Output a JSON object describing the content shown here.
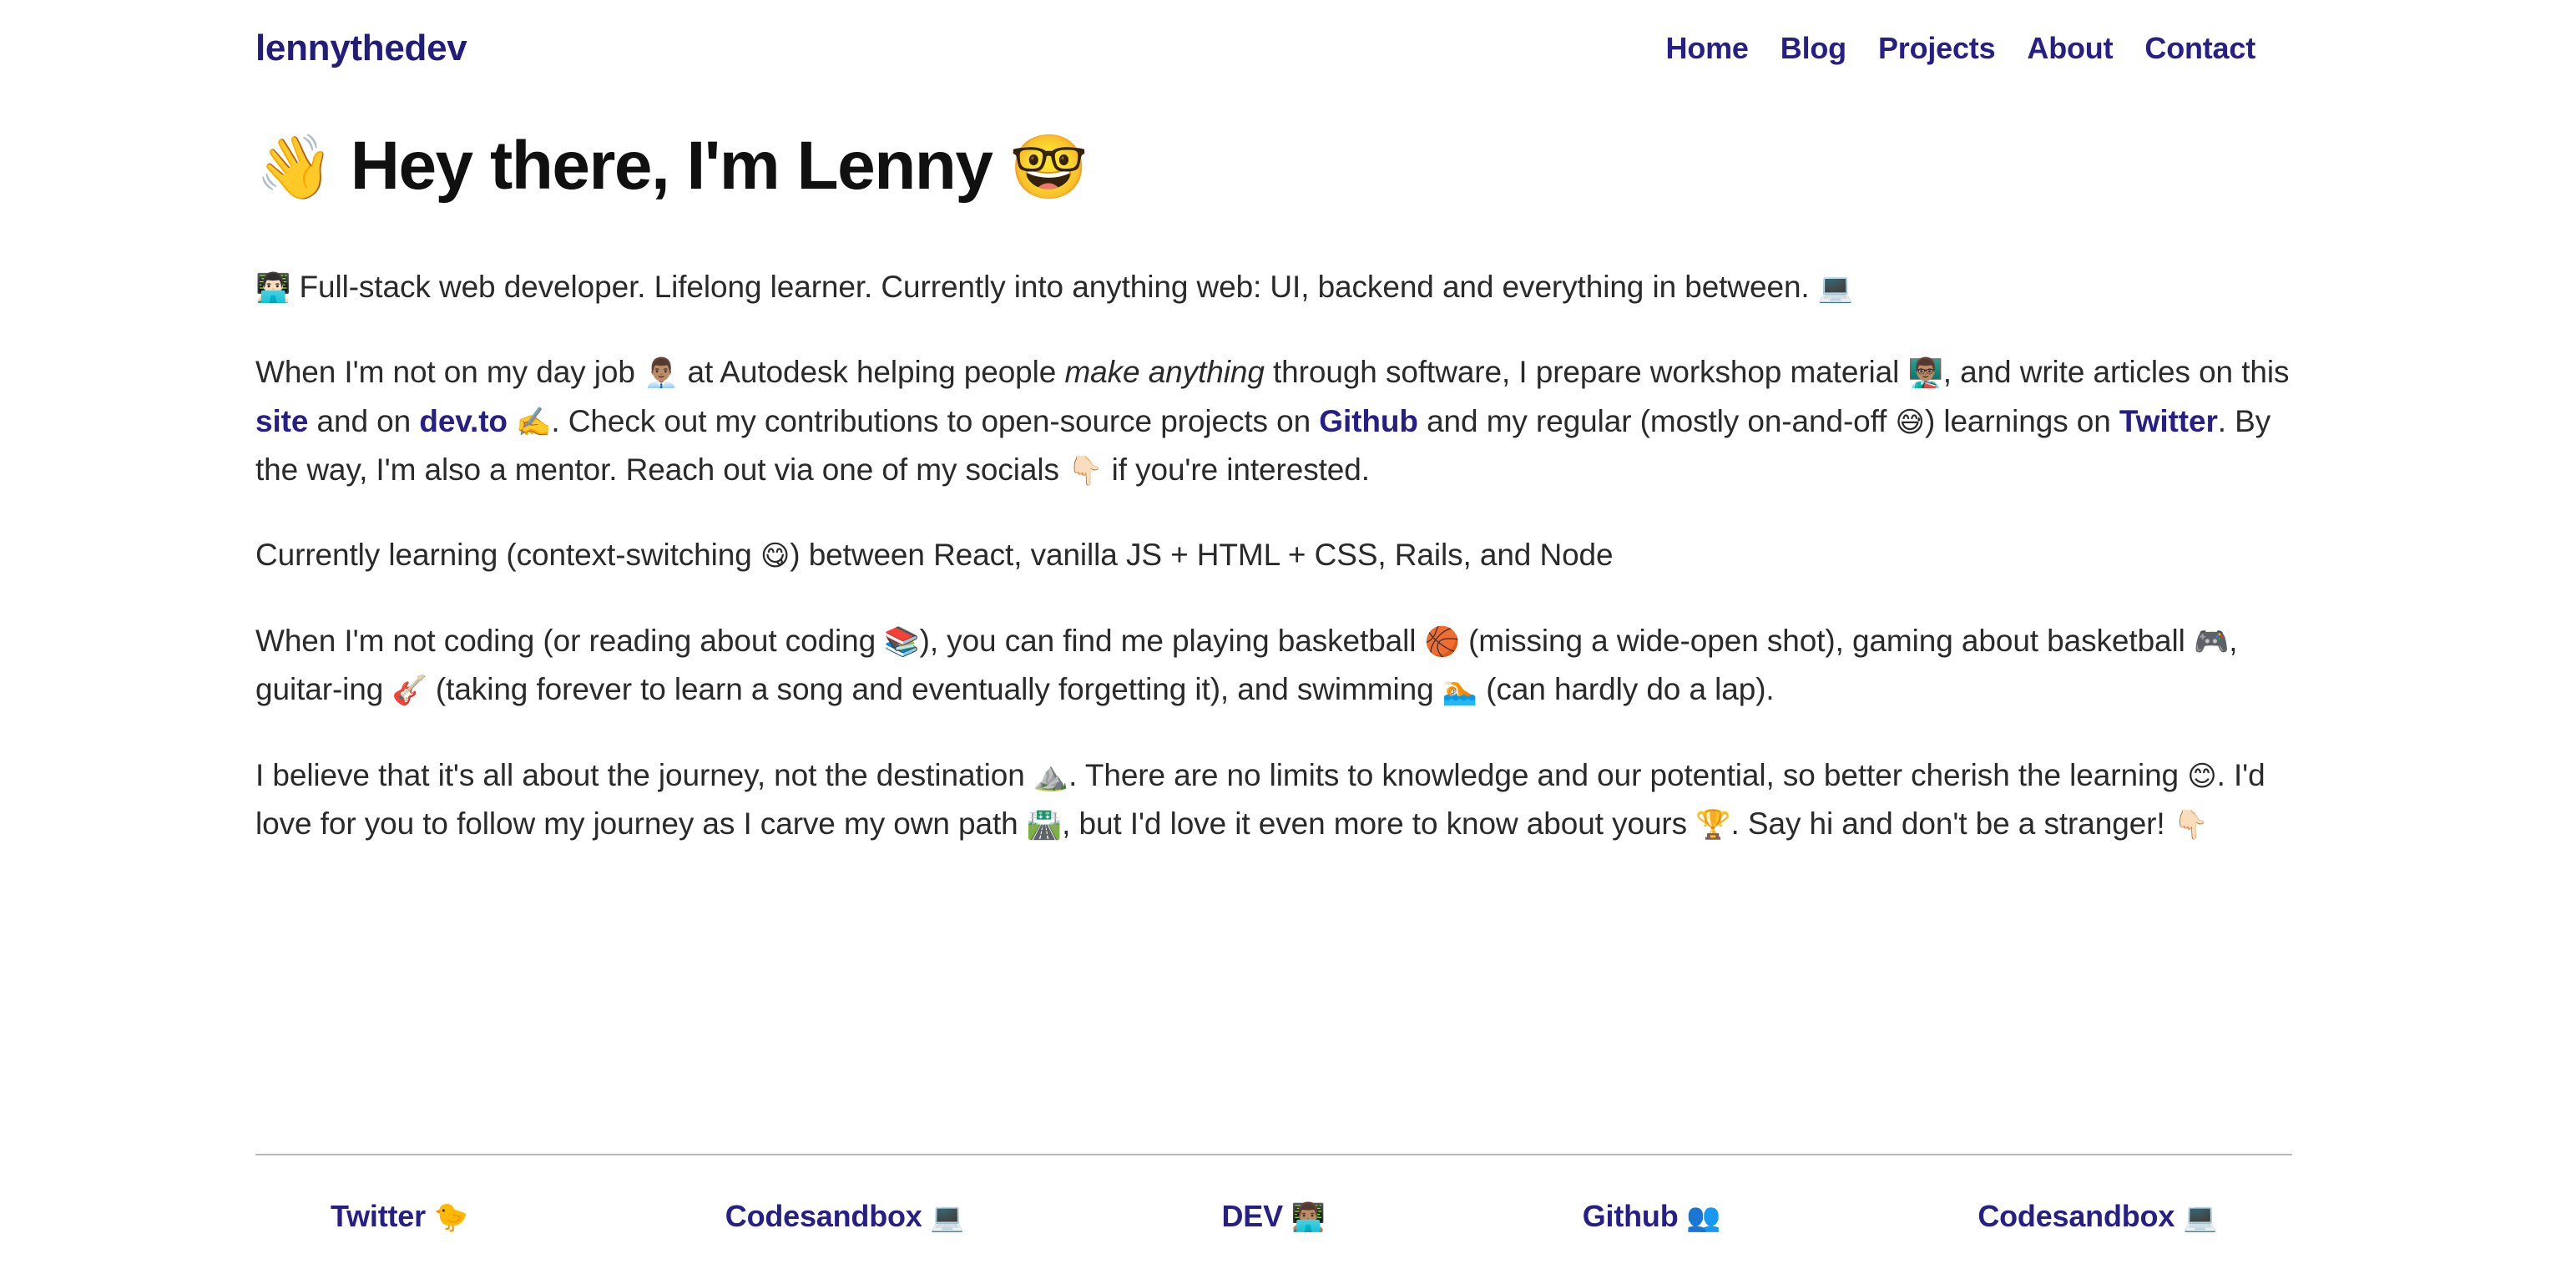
{
  "header": {
    "brand": "lennythedev",
    "nav": [
      {
        "label": "Home",
        "name": "nav-link-home"
      },
      {
        "label": "Blog",
        "name": "nav-link-blog"
      },
      {
        "label": "Projects",
        "name": "nav-link-projects"
      },
      {
        "label": "About",
        "name": "nav-link-about"
      },
      {
        "label": "Contact",
        "name": "nav-link-contact"
      }
    ]
  },
  "main": {
    "title": {
      "wave_emoji": "👋",
      "text": "Hey there, I'm Lenny",
      "nerd_emoji": "🤓"
    },
    "paragraphs": {
      "p1": {
        "emoji_person": "👨🏻‍💻",
        "text": "Full-stack web developer. Lifelong learner. Currently into anything web: UI, backend and everything in between.",
        "emoji_laptop": "💻"
      },
      "p2": {
        "t1": "When I'm not on my day job",
        "emoji_office_worker": "👨🏽‍💼",
        "t2": "at Autodesk helping people",
        "italic": "make anything",
        "t3": "through software, I prepare workshop material",
        "emoji_teacher": "👨🏽‍🏫",
        "t4": ", and write articles on this",
        "link_site": "site",
        "t5": "and on",
        "link_devto": "dev.to",
        "emoji_writing": "✍️",
        "t6": ". Check out my contributions to open-source projects on",
        "link_github": "Github",
        "t7": "and my regular (mostly on-and-off",
        "emoji_sweat_smile": "😅",
        "t8": ") learnings on",
        "link_twitter": "Twitter",
        "t9": ". By the way, I'm also a mentor. Reach out via one of my socials",
        "emoji_point_down": "👇🏻",
        "t10": "if you're interested."
      },
      "p3": {
        "t1": "Currently learning (context-switching",
        "emoji_relieved": "😋",
        "t2": ") between React, vanilla JS + HTML + CSS, Rails, and Node"
      },
      "p4": {
        "t1": "When I'm not coding (or reading about coding",
        "emoji_books": "📚",
        "t2": "), you can find me playing basketball",
        "emoji_basketball": "🏀",
        "t3": "(missing a wide-open shot), gaming about basketball",
        "emoji_gamepad": "🎮",
        "t4": ", guitar-ing",
        "emoji_guitar": "🎸",
        "t5": "(taking forever to learn a song and eventually forgetting it), and swimming",
        "emoji_swimmer": "🏊🏻",
        "t6": "(can hardly do a lap)."
      },
      "p5": {
        "t1": "I believe that it's all about the journey, not the destination",
        "emoji_mountain": "⛰️",
        "t2": ". There are no limits to knowledge and our potential, so better cherish the learning",
        "emoji_smile": "😊",
        "t3": ". I'd love for you to follow my journey as I carve my own path",
        "emoji_road": "🛣️",
        "t4": ", but I'd love it even more to know about yours",
        "emoji_trophy": "🏆",
        "t5": ". Say hi and don't be a stranger!",
        "emoji_point_down": "👇🏻"
      }
    }
  },
  "footer": {
    "links": [
      {
        "label": "Twitter",
        "emoji": "🐤",
        "name": "footer-link-twitter"
      },
      {
        "label": "Codesandbox",
        "emoji": "💻",
        "name": "footer-link-codesandbox-1"
      },
      {
        "label": "DEV",
        "emoji": "👨🏽‍💻",
        "name": "footer-link-dev"
      },
      {
        "label": "Github",
        "emoji": "👥",
        "name": "footer-link-github"
      },
      {
        "label": "Codesandbox",
        "emoji": "💻",
        "name": "footer-link-codesandbox-2"
      }
    ]
  },
  "colors": {
    "brand_navy": "#231d7a",
    "link_navy": "#251f86",
    "body_text": "#2a2a2a",
    "heading": "#101010",
    "rule": "#b9b9b9",
    "background": "#ffffff"
  }
}
